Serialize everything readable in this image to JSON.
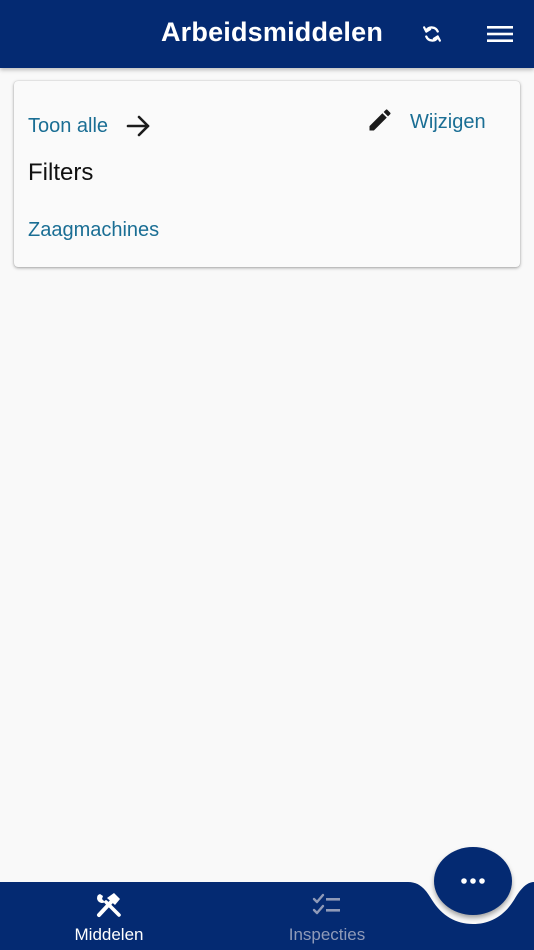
{
  "header": {
    "title": "Arbeidsmiddelen",
    "refresh_icon": "refresh-icon",
    "menu_icon": "hamburger-menu-icon"
  },
  "filter_card": {
    "show_all_label": "Toon alle",
    "edit_label": "Wijzigen",
    "title": "Filters",
    "filters": [
      "Zaagmachines"
    ]
  },
  "bottom_nav": {
    "tabs": [
      {
        "label": "Middelen",
        "icon": "tools-icon",
        "active": true
      },
      {
        "label": "Inspecties",
        "icon": "checklist-icon",
        "active": false
      }
    ]
  },
  "fab": {
    "icon": "more-horizontal-icon"
  },
  "colors": {
    "primary": "#042a72",
    "link": "#1a6e94",
    "background": "#f9f9f9",
    "inactive_tab": "#8f9ab8"
  }
}
